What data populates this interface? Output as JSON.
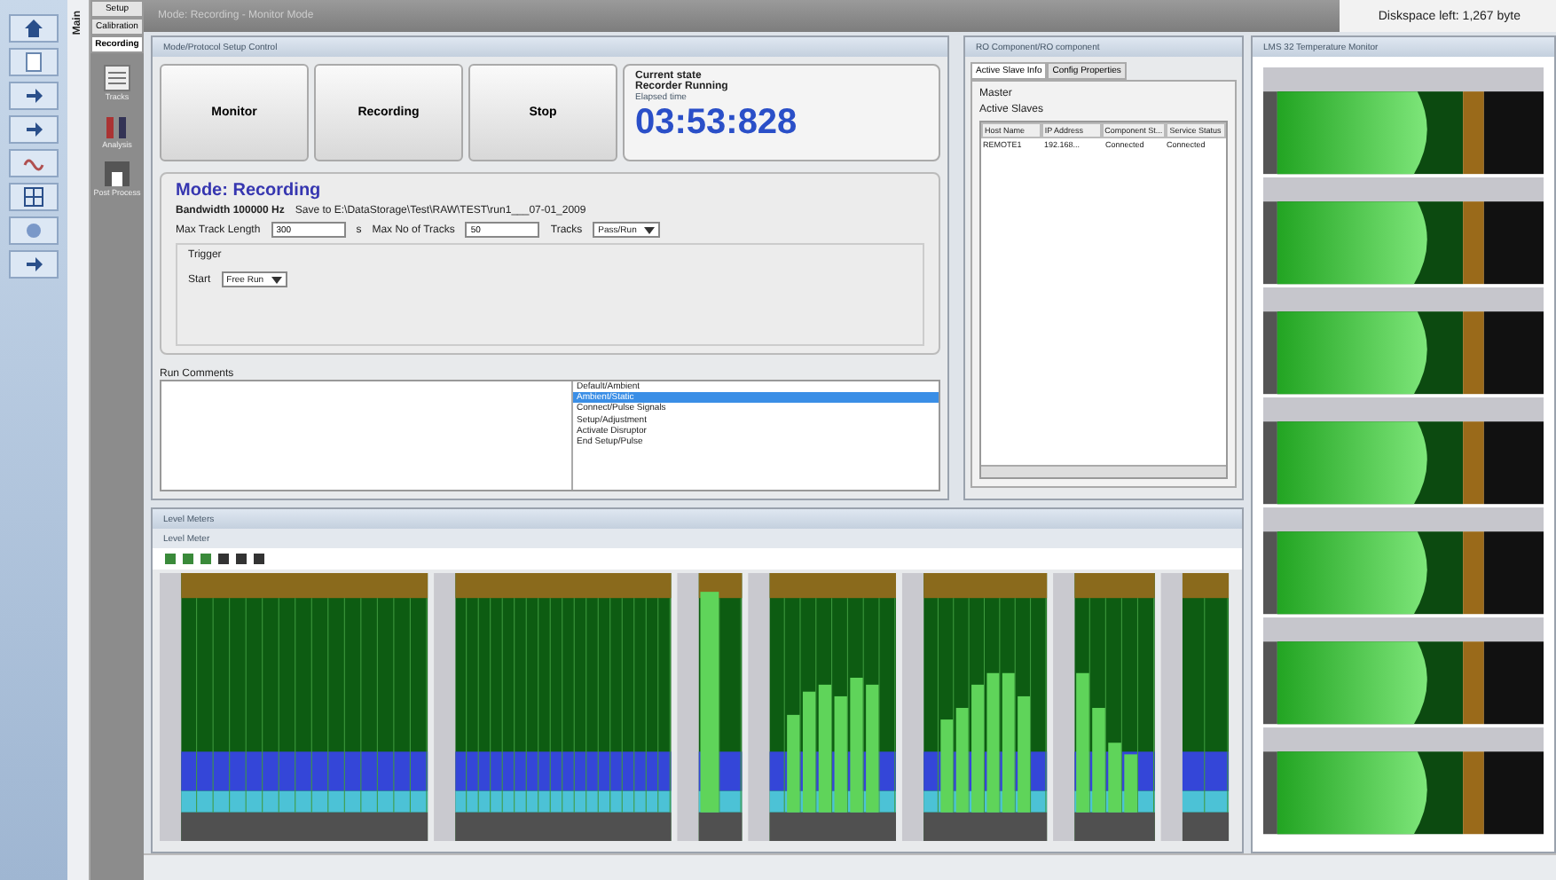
{
  "nav": {
    "main_tab": "Main",
    "tabs": [
      {
        "label": "Setup",
        "selected": false
      },
      {
        "label": "Calibration",
        "selected": false
      },
      {
        "label": "Recording",
        "selected": true
      }
    ],
    "tools": [
      {
        "label": "Tracks"
      },
      {
        "label": "Analysis"
      },
      {
        "label": "Post Process"
      }
    ]
  },
  "title_bar": {
    "title": "Mode: Recording - Monitor Mode",
    "diskspace": "Diskspace left: 1,267 byte"
  },
  "setup_panel": {
    "title": "Mode/Protocol Setup Control",
    "buttons": [
      "Monitor",
      "Recording",
      "Stop"
    ],
    "state_label": "Current state",
    "state": "Recorder Running",
    "elapsed_label": "Elapsed time",
    "elapsed": "03:53:828",
    "mode": "Mode: Recording",
    "bandwidth": "Bandwidth 100000 Hz",
    "save_path": "Save to E:\\DataStorage\\Test\\RAW\\TEST\\run1___07-01_2009",
    "max_track_label": "Max Track Length",
    "max_track": "300",
    "unit": "s",
    "max_tracks_label": "Max No of Tracks",
    "max_tracks": "50",
    "tracks_label": "Tracks",
    "tracks": "Pass/Run",
    "trigger": "Trigger",
    "start_label": "Start",
    "start": "Free Run",
    "comments_label": "Run Comments",
    "comment_options": [
      {
        "label": "Default/Ambient",
        "selected": false
      },
      {
        "label": "Ambient/Static",
        "selected": true
      },
      {
        "label": "Connect/Pulse Signals",
        "selected": false
      },
      {
        "label": "Setup/Adjustment",
        "selected": false
      },
      {
        "label": "Activate Disruptor",
        "selected": false
      },
      {
        "label": "End Setup/Pulse",
        "selected": false
      }
    ]
  },
  "ro_panel": {
    "title": "RO Component/RO component",
    "tabs": [
      {
        "label": "Active Slave Info",
        "selected": true
      },
      {
        "label": "Config Properties",
        "selected": false
      }
    ],
    "master": "Master",
    "slaves_label": "Active Slaves",
    "columns": [
      "Host Name",
      "IP Address",
      "Component St...",
      "Service Status"
    ],
    "rows": [
      [
        "REMOTE1",
        "192.168...",
        "Connected",
        "Connected"
      ]
    ]
  },
  "temp_panel": {
    "title": "LMS 32 Temperature Monitor"
  },
  "level_panel": {
    "title": "Level Meters",
    "subtitle": "Level Meter"
  }
}
